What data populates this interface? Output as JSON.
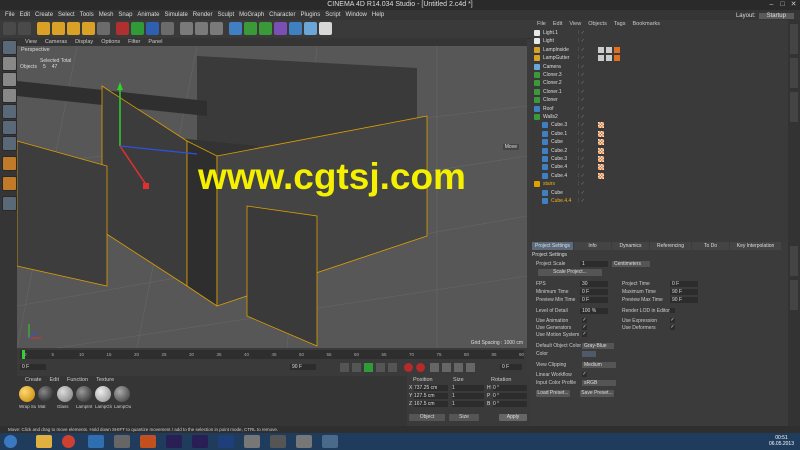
{
  "window": {
    "title": "CINEMA 4D R14.034 Studio - [Untitled 2.c4d *]"
  },
  "menubar": {
    "items": [
      "File",
      "Edit",
      "Create",
      "Select",
      "Tools",
      "Mesh",
      "Snap",
      "Animate",
      "Simulate",
      "Render",
      "Sculpt",
      "MoGraph",
      "Character",
      "Plugins",
      "Script",
      "Window",
      "Help"
    ],
    "layout_label": "Layout:",
    "layout_value": "Startup"
  },
  "viewport": {
    "menu": [
      "View",
      "Cameras",
      "Display",
      "Options",
      "Filter",
      "Panel"
    ],
    "name": "Perspective",
    "stats_header": "Selected Total",
    "stats_label": "Objects",
    "stats_selected": "5",
    "stats_total": "47",
    "move_label": "Move",
    "grid_spacing": "Grid Spacing : 1000 cm",
    "watermark": "www.cgtsj.com"
  },
  "timeline": {
    "ticks": [
      "0",
      "5",
      "10",
      "15",
      "20",
      "25",
      "30",
      "35",
      "40",
      "45",
      "50",
      "55",
      "60",
      "65",
      "70",
      "75",
      "80",
      "85",
      "90"
    ],
    "current_frame": "0 F",
    "start_frame": "0 F",
    "end_frame": "90 F",
    "frame_readout": "0 F"
  },
  "materials": {
    "menu": [
      "Create",
      "Edit",
      "Function",
      "Texture"
    ],
    "items": [
      "Wrap Sub",
      "Mat",
      "Glass",
      "LampInt",
      "LampGlo",
      "LampOu"
    ]
  },
  "coordinates": {
    "headers": [
      "Position",
      "Size",
      "Rotation"
    ],
    "rows": [
      {
        "axis": "X",
        "pos": "737.25 cm",
        "size": "1",
        "rot_axis": "H",
        "rot": "0 °"
      },
      {
        "axis": "Y",
        "pos": "127.5 cm",
        "size": "1",
        "rot_axis": "P",
        "rot": "0 °"
      },
      {
        "axis": "Z",
        "pos": "167.5 cm",
        "size": "1",
        "rot_axis": "B",
        "rot": "0 °"
      }
    ],
    "mode_object": "Object",
    "mode_size": "Size",
    "apply": "Apply"
  },
  "object_manager": {
    "menu": [
      "File",
      "Edit",
      "View",
      "Objects",
      "Tags",
      "Bookmarks"
    ],
    "objects": [
      "Light.1",
      "Light",
      "LampInside",
      "LampGutter",
      "Camera",
      "Cloner.3",
      "Cloner.2",
      "Cloner.1",
      "Cloner",
      "Roof",
      "Walls2",
      "Cube.3",
      "Cube.1",
      "Cube",
      "Cube.2",
      "Cube.3",
      "Cube.4",
      "Cube.4",
      "stairs",
      "Cube",
      "Cube.4.4"
    ]
  },
  "attributes": {
    "tabs": [
      "Project Settings",
      "Info",
      "Dynamics",
      "Referencing",
      "To Do",
      "Key Interpolation"
    ],
    "header": "Project Settings",
    "project_scale_label": "Project Scale",
    "project_scale_value": "1",
    "project_scale_unit": "Centimeters",
    "scale_button": "Scale Project...",
    "fps_label": "FPS",
    "fps_value": "30",
    "project_time_label": "Project Time",
    "project_time_value": "0 F",
    "min_time_label": "Minimum Time",
    "min_time_value": "0 F",
    "max_time_label": "Maximum Time",
    "max_time_value": "90 F",
    "preview_min_label": "Preview Min Time",
    "preview_min_value": "0 F",
    "preview_max_label": "Preview Max Time",
    "preview_max_value": "90 F",
    "lod_label": "Level of Detail",
    "lod_value": "100 %",
    "render_lod_label": "Render LOD in Editor",
    "use_animation": "Use Animation",
    "use_expression": "Use Expression",
    "use_generators": "Use Generators",
    "use_deformers": "Use Deformers",
    "use_motion": "Use Motion System",
    "default_color_label": "Default Object Color",
    "default_color_value": "Gray-Blue",
    "color_label": "Color",
    "view_clipping_label": "View Clipping",
    "view_clipping_value": "Medium",
    "linear_workflow": "Linear Workflow",
    "input_profile_label": "Input Color Profile",
    "input_profile_value": "sRGB",
    "load_preset": "Load Preset...",
    "save_preset": "Save Preset..."
  },
  "status": {
    "text": "Move: Click and drag to move elements. Hold down SHIFT to quantize movement / add to the selection in point mode, CTRL to remove."
  },
  "taskbar": {
    "time": "00:51",
    "date": "06.05.2013"
  }
}
